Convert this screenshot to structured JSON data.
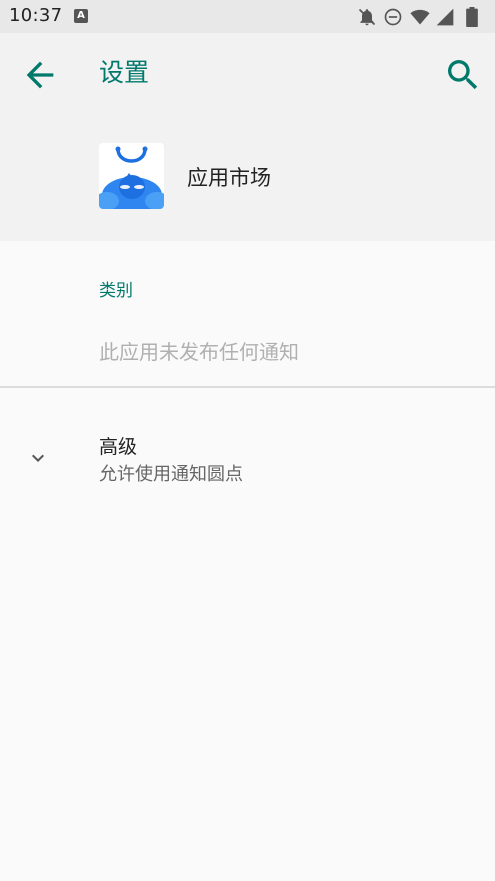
{
  "status_bar": {
    "time": "10:37",
    "notification_icon": "A",
    "icons": [
      "notifications-off-icon",
      "do-not-disturb-icon",
      "wifi-icon",
      "signal-icon",
      "battery-icon"
    ]
  },
  "header": {
    "title": "设置",
    "back_icon": "arrow-back-icon",
    "search_icon": "search-icon",
    "app_name": "应用市场"
  },
  "content": {
    "category_label": "类别",
    "no_notifications_text": "此应用未发布任何通知"
  },
  "advanced": {
    "title": "高级",
    "subtitle": "允许使用通知圆点",
    "icon": "chevron-down-icon"
  },
  "colors": {
    "accent": "#00796b",
    "header_bg": "#f2f2f2",
    "page_bg": "#fafafa",
    "status_bar_bg": "#e8e8e8"
  }
}
